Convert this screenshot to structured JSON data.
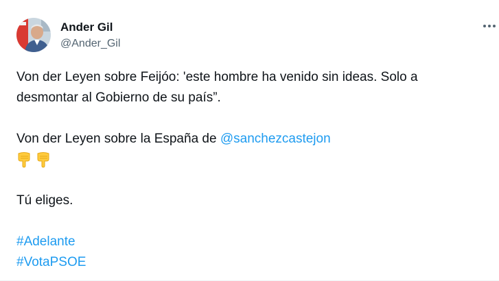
{
  "author": {
    "name": "Ander Gil",
    "handle": "@Ander_Gil"
  },
  "tweet": {
    "paragraph1_line1": "Von der Leyen sobre  Feijóo: 'este hombre ha venido sin ideas. Solo a",
    "paragraph1_line2": "desmontar al Gobierno de su país”.",
    "paragraph2_prefix": "Von der Leyen sobre la España de ",
    "mention": "@sanchezcastejon",
    "emojis": [
      "backhand-index-pointing-down",
      "backhand-index-pointing-down"
    ],
    "paragraph3": "Tú eliges.",
    "hashtags": [
      "#Adelante",
      "#VotaPSOE"
    ]
  },
  "colors": {
    "text": "#0f1419",
    "secondary": "#536471",
    "link": "#1d9bf0",
    "emoji": "#ffcb3d"
  },
  "icons": {
    "more": "more-horizontal-icon"
  }
}
